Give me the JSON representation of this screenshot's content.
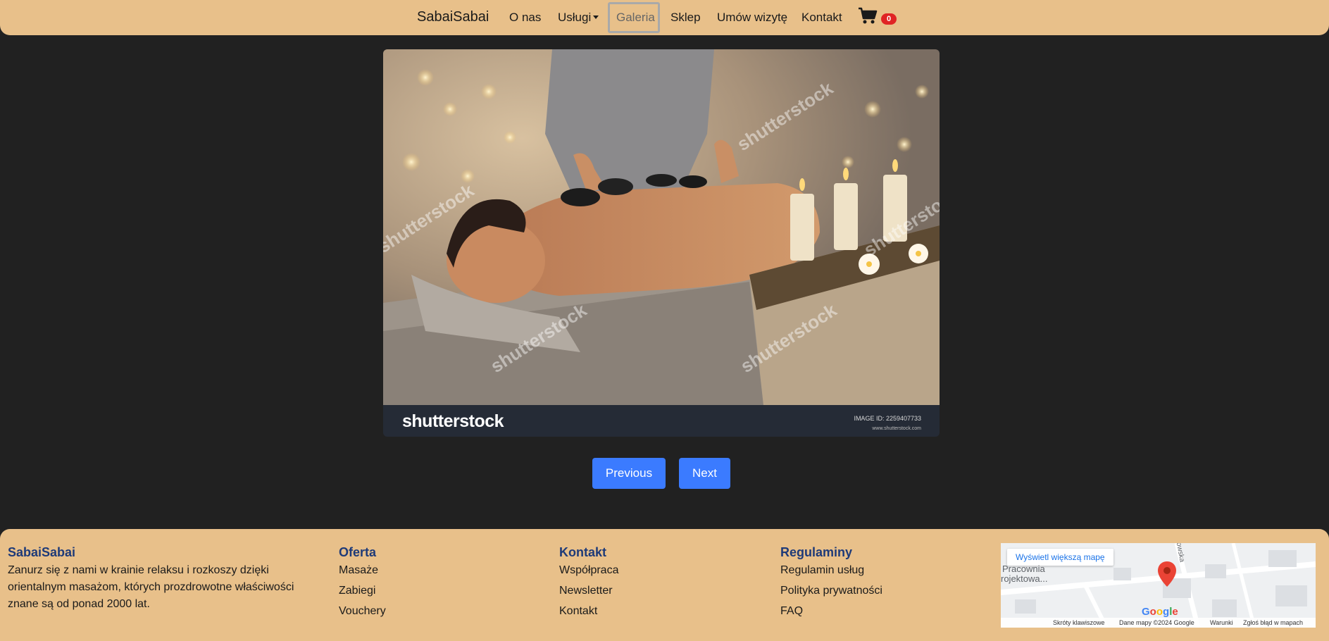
{
  "nav": {
    "brand": "SabaiSabai",
    "items": [
      {
        "label": "O nas"
      },
      {
        "label": "Usługi"
      },
      {
        "label": "Galeria"
      },
      {
        "label": "Sklep"
      },
      {
        "label": "Umów wizytę"
      },
      {
        "label": "Kontakt"
      }
    ],
    "cart_count": "0",
    "active_item": "Galeria"
  },
  "gallery": {
    "watermark": "shutterstock",
    "image_id": "IMAGE ID: 2259407733",
    "url": "www.shutterstock.com",
    "previous_label": "Previous",
    "next_label": "Next"
  },
  "footer": {
    "brand": {
      "title": "SabaiSabai",
      "description": "Zanurz się z nami w krainie relaksu i rozkoszy dzięki orientalnym masażom, których prozdrowotne właściwości znane są od ponad 2000 lat."
    },
    "oferta": {
      "title": "Oferta",
      "items": [
        "Masaże",
        "Zabiegi",
        "Vouchery"
      ]
    },
    "kontakt": {
      "title": "Kontakt",
      "items": [
        "Współpraca",
        "Newsletter",
        "Kontakt"
      ]
    },
    "regulaminy": {
      "title": "Regulaminy",
      "items": [
        "Regulamin usług",
        "Polityka prywatności",
        "FAQ"
      ]
    }
  },
  "map": {
    "view_larger": "Wyświetl większą mapę",
    "place_label_1": "Pracownia",
    "place_label_2": "rojektowa...",
    "street": "owska",
    "logo": "Google",
    "shortcuts": "Skróty klawiszowe",
    "data": "Dane mapy ©2024 Google",
    "terms": "Warunki",
    "report": "Zgłoś błąd w mapach"
  },
  "colors": {
    "nav_bg": "#e8c08a",
    "page_bg": "#212121",
    "button_bg": "#3b7bff",
    "footer_title": "#1e3a78",
    "badge_bg": "#e02424"
  }
}
